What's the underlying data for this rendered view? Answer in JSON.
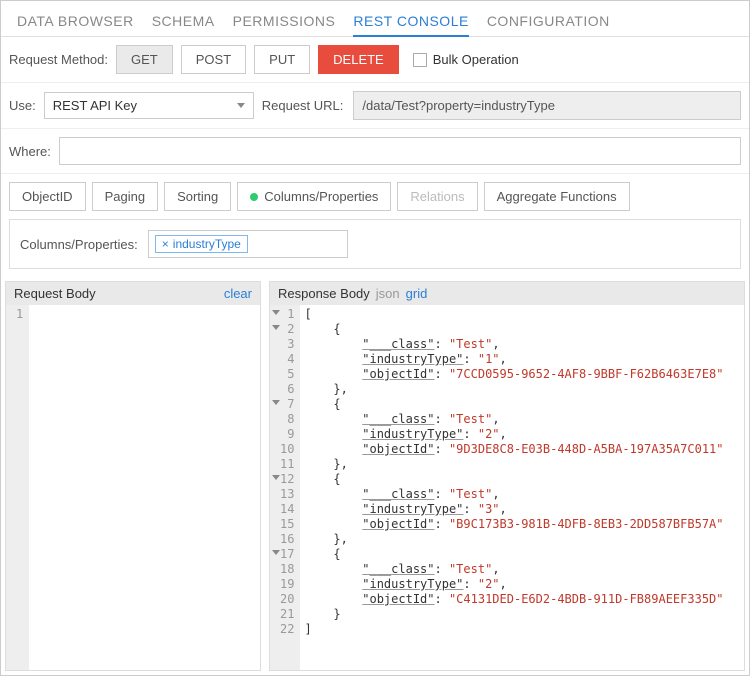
{
  "tabs": {
    "data_browser": "DATA BROWSER",
    "schema": "SCHEMA",
    "permissions": "PERMISSIONS",
    "rest_console": "REST CONSOLE",
    "configuration": "CONFIGURATION"
  },
  "method_row": {
    "label": "Request Method:",
    "get": "GET",
    "post": "POST",
    "put": "PUT",
    "delete": "DELETE",
    "bulk_label": "Bulk Operation"
  },
  "use_row": {
    "label": "Use:",
    "selected": "REST API Key",
    "url_label": "Request URL:",
    "url_value": "/data/Test?property=industryType"
  },
  "where_row": {
    "label": "Where:",
    "value": ""
  },
  "opts": {
    "objectid": "ObjectID",
    "paging": "Paging",
    "sorting": "Sorting",
    "columns": "Columns/Properties",
    "relations": "Relations",
    "aggregate": "Aggregate Functions"
  },
  "cp": {
    "label": "Columns/Properties:",
    "tag0": "industryType"
  },
  "req": {
    "title": "Request Body",
    "clear": "clear"
  },
  "res": {
    "title": "Response Body",
    "json": "json",
    "grid": "grid"
  },
  "chart_data": {
    "type": "table",
    "title": "Response Body",
    "columns": [
      "___class",
      "industryType",
      "objectId"
    ],
    "rows": [
      [
        "Test",
        "1",
        "7CCD0595-9652-4AF8-9BBF-F62B6463E7E8"
      ],
      [
        "Test",
        "2",
        "9D3DE8C8-E03B-448D-A5BA-197A35A7C011"
      ],
      [
        "Test",
        "3",
        "B9C173B3-981B-4DFB-8EB3-2DD587BFB57A"
      ],
      [
        "Test",
        "2",
        "C4131DED-E6D2-4BDB-911D-FB89AEEF335D"
      ]
    ]
  }
}
